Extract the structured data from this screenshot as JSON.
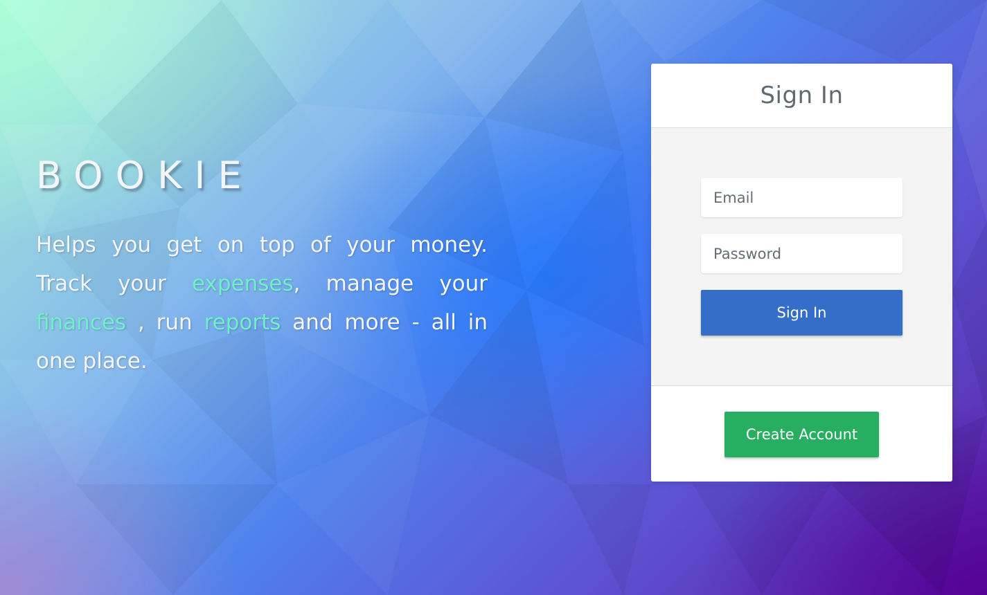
{
  "brand": {
    "name": "BOOKIE"
  },
  "tagline": {
    "part1": "Helps you get on top of your money. Track your ",
    "highlight1": "expenses",
    "part2": ", manage your ",
    "highlight2": "finances",
    "part3": " , run ",
    "highlight3": "reports",
    "part4": " and more - all in one place."
  },
  "signin_card": {
    "title": "Sign In",
    "email_placeholder": "Email",
    "password_placeholder": "Password",
    "submit_label": "Sign In",
    "create_account_label": "Create Account"
  },
  "colors": {
    "highlight": "#6ef0c8",
    "signin_button": "#346ec9",
    "create_account_button": "#27ae60"
  }
}
